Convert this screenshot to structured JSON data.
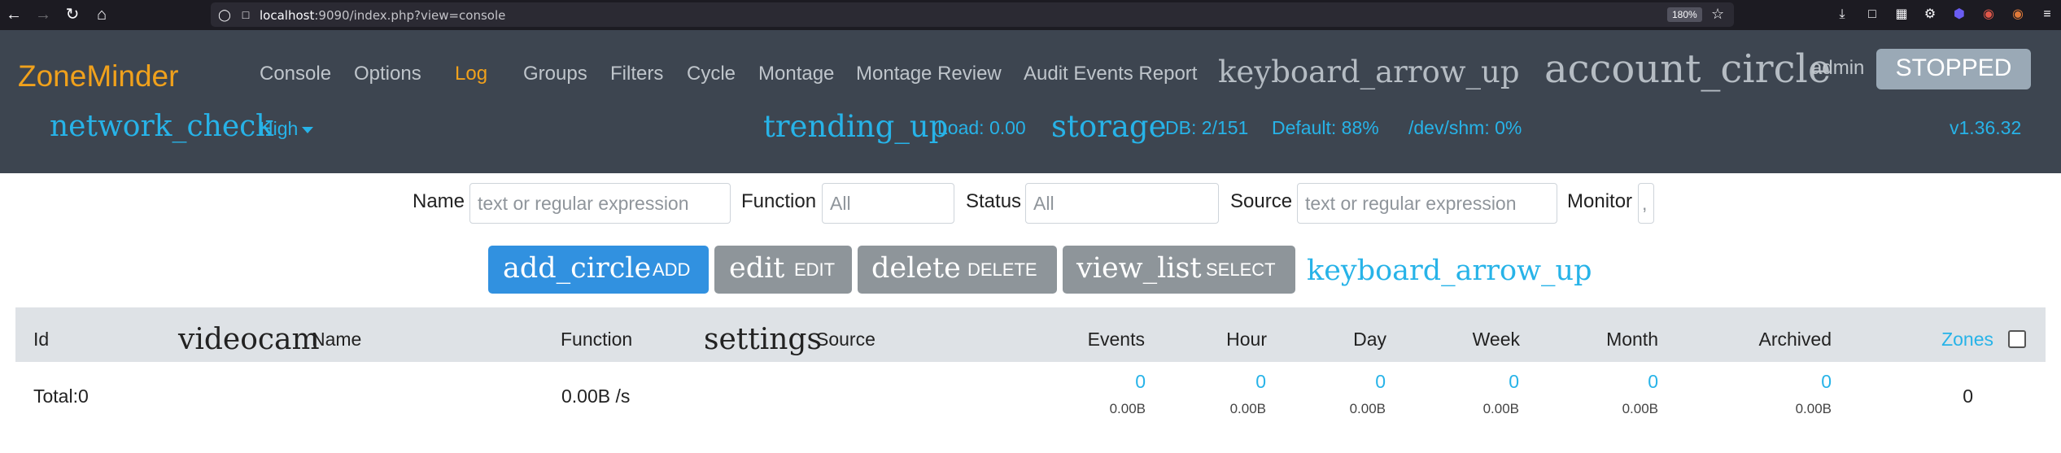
{
  "browser": {
    "url_host": "localhost",
    "url_rest": ":9090/index.php?view=console",
    "zoom": "180%"
  },
  "header": {
    "brand": "ZoneMinder",
    "menu": [
      "Console",
      "Options",
      "Log",
      "Groups",
      "Filters",
      "Cycle",
      "Montage",
      "Montage Review",
      "Audit Events Report"
    ],
    "active_menu": "Log",
    "arrow_icon": "keyboard_arrow_up",
    "account_icon": "account_circle",
    "user": "admin",
    "state_button": "STOPPED",
    "network_icon": "network_check",
    "bandwidth": "High",
    "trend_icon": "trending_up",
    "load": "Load: 0.00",
    "storage_icon": "storage",
    "db": "DB: 2/151",
    "default_storage": "Default: 88%",
    "shm": "/dev/shm: 0%",
    "version": "v1.36.32"
  },
  "filters": {
    "name_label": "Name",
    "name_placeholder": "text or regular expression",
    "function_label": "Function",
    "function_placeholder": "All",
    "status_label": "Status",
    "status_placeholder": "All",
    "source_label": "Source",
    "source_placeholder": "text or regular expression",
    "monitor_label": "Monitor",
    "monitor_placeholder": ","
  },
  "actions": {
    "add_icon": "add_circle",
    "add_label": "ADD",
    "edit_icon": "edit",
    "edit_label": "EDIT",
    "delete_icon": "delete",
    "delete_label": "DELETE",
    "select_icon": "view_list",
    "select_label": "SELECT",
    "toggle_icon": "keyboard_arrow_up"
  },
  "table": {
    "headers": {
      "id": "Id",
      "name_icon": "videocam",
      "name": "Name",
      "function": "Function",
      "source_icon": "settings",
      "source": "Source",
      "events": "Events",
      "hour": "Hour",
      "day": "Day",
      "week": "Week",
      "month": "Month",
      "archived": "Archived",
      "zones": "Zones"
    },
    "total": {
      "label": "Total:0",
      "bandwidth": "0.00B /s",
      "events_count": "0",
      "events_size": "0.00B",
      "hour_count": "0",
      "hour_size": "0.00B",
      "day_count": "0",
      "day_size": "0.00B",
      "week_count": "0",
      "week_size": "0.00B",
      "month_count": "0",
      "month_size": "0.00B",
      "archived_count": "0",
      "archived_size": "0.00B",
      "zones": "0"
    }
  }
}
